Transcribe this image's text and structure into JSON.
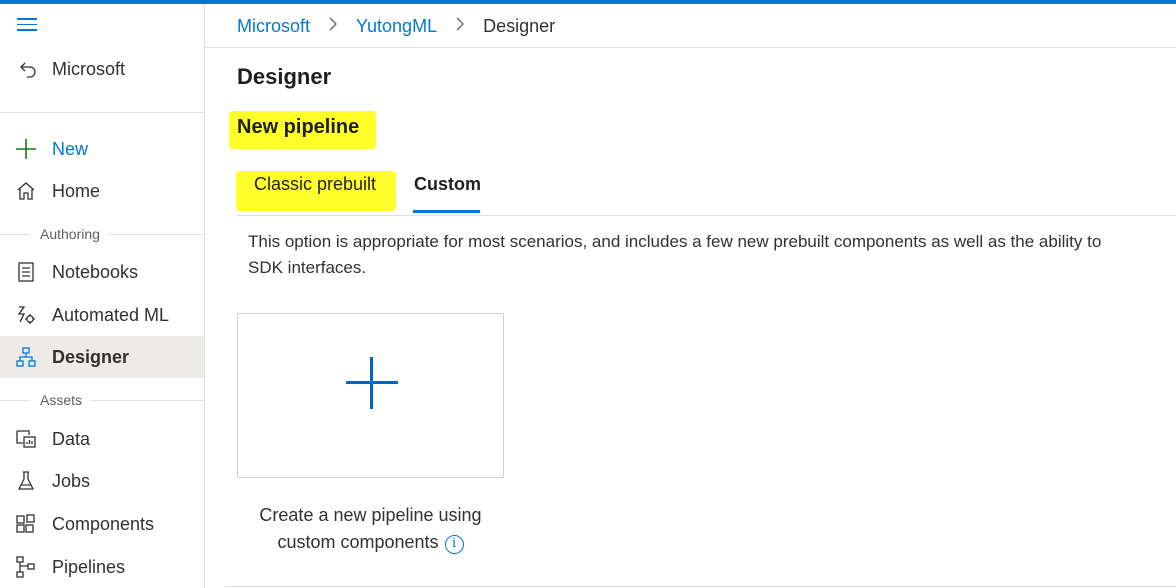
{
  "sidebar": {
    "workspace_label": "Microsoft",
    "new_label": "New",
    "home_label": "Home",
    "sections": {
      "authoring": "Authoring",
      "assets": "Assets"
    },
    "items": [
      {
        "label": "Notebooks",
        "icon": "notebook-icon"
      },
      {
        "label": "Automated ML",
        "icon": "automated-ml-icon"
      },
      {
        "label": "Designer",
        "icon": "designer-icon",
        "active": true
      },
      {
        "label": "Data",
        "icon": "data-icon"
      },
      {
        "label": "Jobs",
        "icon": "jobs-flask-icon"
      },
      {
        "label": "Components",
        "icon": "components-icon"
      },
      {
        "label": "Pipelines",
        "icon": "pipelines-icon"
      }
    ]
  },
  "breadcrumb": {
    "items": [
      "Microsoft",
      "YutongML",
      "Designer"
    ],
    "separator": ">"
  },
  "page": {
    "title": "Designer",
    "subtitle": "New pipeline",
    "tabs": [
      "Classic prebuilt",
      "Custom"
    ],
    "active_tab": "Custom",
    "description": "This option is appropriate for most scenarios, and includes a few new prebuilt components as well as the ability to\nSDK interfaces."
  },
  "card": {
    "caption_line1": "Create a new pipeline using",
    "caption_line2": "custom components",
    "info_glyph": "i"
  },
  "colors": {
    "accent": "#0078d4",
    "highlight": "#ffff2b",
    "new_plus": "#107c10"
  }
}
